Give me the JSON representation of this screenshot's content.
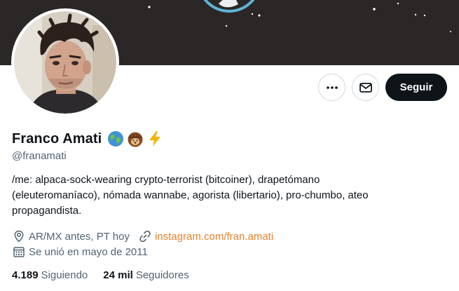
{
  "profile": {
    "display_name": "Franco Amati",
    "handle": "@franamati",
    "name_emojis": [
      "globe-emoji",
      "hedgehog-emoji",
      "lightning-emoji"
    ],
    "bio_lines": [
      "/me: alpaca-sock-wearing crypto-terrorist (bitcoiner), drapetómano",
      "(eleuteromaníaco), nómada wannabe, agorista (libertario), pro-chumbo, ateo",
      "propagandista."
    ],
    "location": "AR/MX antes, PT hoy",
    "website": "instagram.com/fran.amati",
    "joined": "Se unió en mayo de 2011"
  },
  "stats": {
    "following_count": "4.189",
    "following_label": "Siguiendo",
    "followers_count": "24 mil",
    "followers_label": "Seguidores"
  },
  "actions": {
    "follow_label": "Seguir",
    "more_icon": "ellipsis-icon",
    "message_icon": "envelope-icon"
  },
  "colors": {
    "banner_bg": "#2a2726",
    "link": "#e7812a",
    "follow_button_bg": "#0f1419",
    "secondary_text": "#536471"
  }
}
